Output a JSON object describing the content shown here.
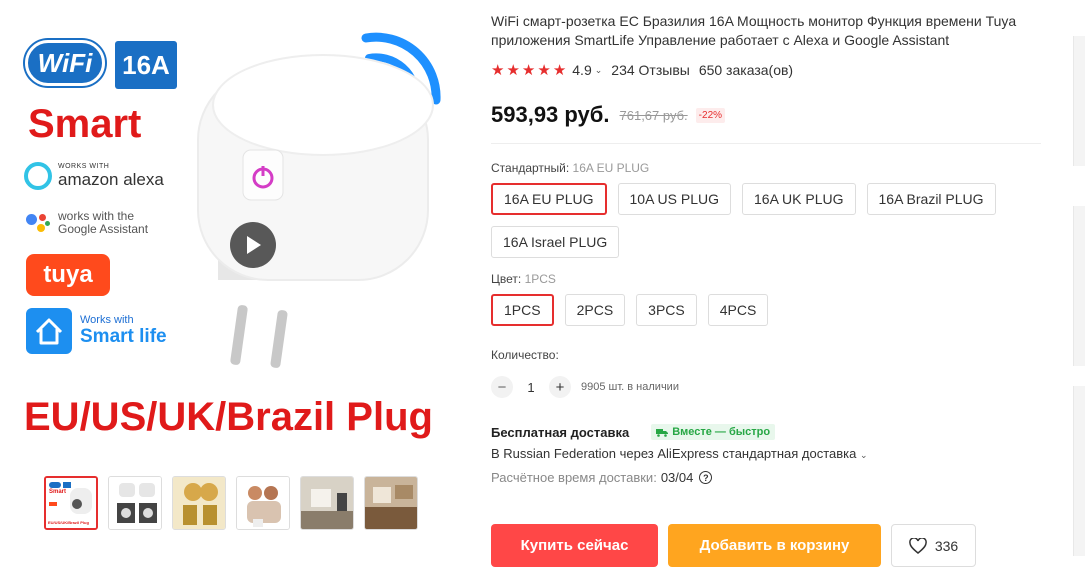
{
  "product": {
    "title": "WiFi смарт-розетка ЕС Бразилия 16A Мощность монитор Функция времени Tuya приложения SmartLife Управление работает с Alexa и Google Assistant",
    "rating": "4.9",
    "stars": 5,
    "reviews": "234 Отзывы",
    "orders": "650 заказа(ов)",
    "price": "593,93 руб.",
    "old_price": "761,67 руб.",
    "discount": "-22%"
  },
  "image": {
    "wifi_badge": "WiFi",
    "amp_badge": "16A",
    "smart": "Smart",
    "alexa_small": "WORKS WITH",
    "alexa_big": "amazon alexa",
    "google_line1": "works with the",
    "google_line2": "Google Assistant",
    "tuya": "tuya",
    "smartlife_small": "Works with",
    "smartlife_big": "Smart life",
    "caption": "EU/US/UK/Brazil Plug",
    "thumb_caption": "EU/US/UK/Brazil Plug",
    "thumb_smart": "Smart",
    "thumbnails": [
      "thumb-1",
      "thumb-2",
      "thumb-3",
      "thumb-4",
      "thumb-5",
      "thumb-6"
    ]
  },
  "options": {
    "standard_label": "Стандартный:",
    "standard_selected": "16A EU PLUG",
    "standards": [
      "16A EU PLUG",
      "10A US PLUG",
      "16A UK PLUG",
      "16A Brazil PLUG",
      "16A Israel PLUG"
    ],
    "color_label": "Цвет:",
    "color_selected": "1PCS",
    "colors": [
      "1PCS",
      "2PCS",
      "3PCS",
      "4PCS"
    ]
  },
  "quantity": {
    "label": "Количество:",
    "minus": "−",
    "value": "1",
    "plus": "+",
    "stock": "9905 шт. в наличии"
  },
  "shipping": {
    "title": "Бесплатная доставка",
    "badge": "Вместе — быстро",
    "via": "В Russian Federation через AliExpress стандартная доставка",
    "time_label": "Расчётное время доставки:",
    "time_value": "03/04",
    "help": "?"
  },
  "actions": {
    "buy": "Купить сейчас",
    "cart": "Добавить в корзину",
    "wish_count": "336"
  },
  "colors": {
    "accent_red": "#ff4747",
    "cart_orange": "#ffa51f",
    "star_red": "#e62e2e",
    "badge_green": "#27a745"
  }
}
